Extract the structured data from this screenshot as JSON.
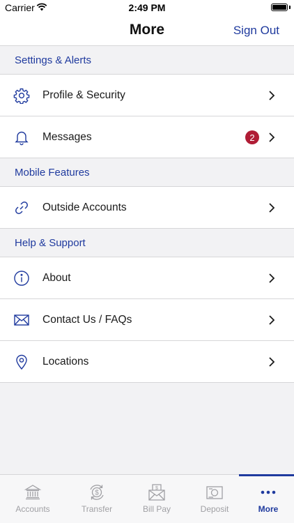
{
  "status": {
    "carrier": "Carrier",
    "time": "2:49 PM"
  },
  "nav": {
    "title": "More",
    "sign_out": "Sign Out"
  },
  "sections": {
    "settings": {
      "header": "Settings & Alerts",
      "profile": {
        "label": "Profile & Security",
        "icon": "gear-icon"
      },
      "messages": {
        "label": "Messages",
        "icon": "bell-icon",
        "badge": "2"
      }
    },
    "mobile": {
      "header": "Mobile Features",
      "outside": {
        "label": "Outside Accounts",
        "icon": "link-icon"
      }
    },
    "help": {
      "header": "Help & Support",
      "about": {
        "label": "About",
        "icon": "info-icon"
      },
      "contact": {
        "label": "Contact Us / FAQs",
        "icon": "envelope-icon"
      },
      "locations": {
        "label": "Locations",
        "icon": "location-pin-icon"
      }
    }
  },
  "tabs": {
    "accounts": {
      "label": "Accounts",
      "icon": "bank-icon"
    },
    "transfer": {
      "label": "Transfer",
      "icon": "transfer-icon"
    },
    "billpay": {
      "label": "Bill Pay",
      "icon": "bill-icon"
    },
    "deposit": {
      "label": "Deposit",
      "icon": "deposit-icon"
    },
    "more": {
      "label": "More",
      "icon": "ellipsis-icon",
      "active": true
    }
  },
  "colors": {
    "accent": "#1f3a9e",
    "badge": "#b01c35",
    "background": "#f2f2f4"
  }
}
